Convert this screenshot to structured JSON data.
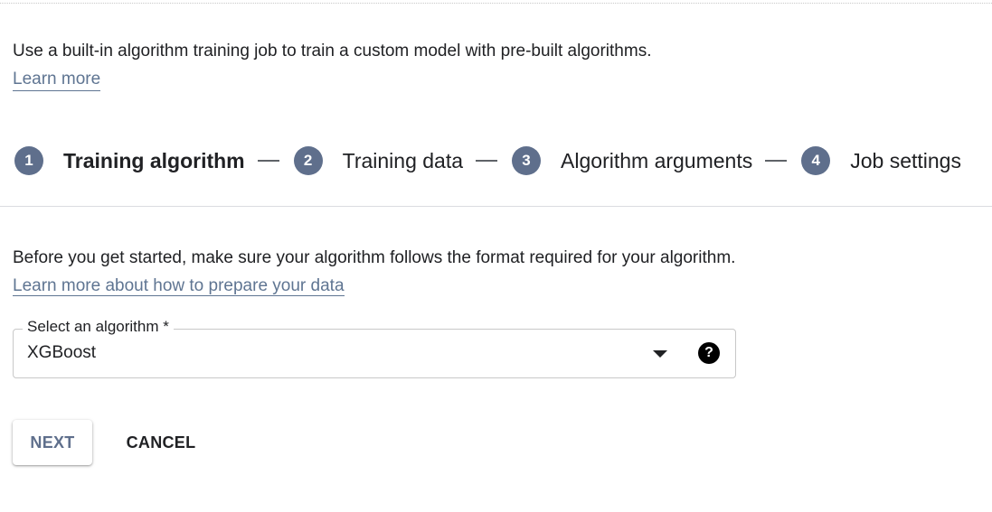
{
  "intro": {
    "description": "Use a built-in algorithm training job to train a custom model with pre-built algorithms.",
    "learn_more": "Learn more"
  },
  "stepper": {
    "steps": [
      {
        "number": "1",
        "label": "Training algorithm",
        "active": true
      },
      {
        "number": "2",
        "label": "Training data",
        "active": false
      },
      {
        "number": "3",
        "label": "Algorithm arguments",
        "active": false
      },
      {
        "number": "4",
        "label": "Job settings",
        "active": false
      }
    ]
  },
  "prep": {
    "text": "Before you get started, make sure your algorithm follows the format required for your algorithm.",
    "link": "Learn more about how to prepare your data"
  },
  "algorithm_select": {
    "label": "Select an algorithm *",
    "value": "XGBoost",
    "help_icon": "help-circle-icon",
    "arrow_icon": "dropdown-arrow-icon"
  },
  "actions": {
    "next_label": "NEXT",
    "cancel_label": "CANCEL"
  },
  "colors": {
    "accent": "#5f6f8c",
    "link": "#5f7592",
    "text": "#202124",
    "divider": "#dadce0"
  }
}
